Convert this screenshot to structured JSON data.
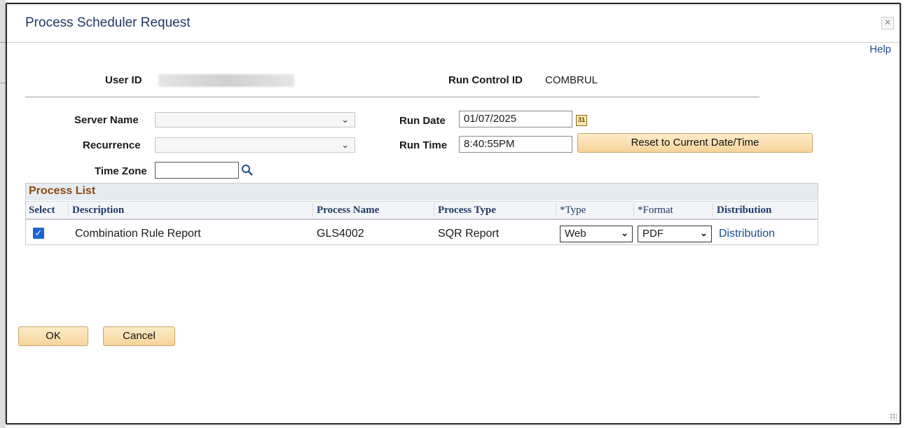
{
  "dialog": {
    "title": "Process Scheduler Request",
    "help": "Help",
    "close_icon": "close-icon"
  },
  "header": {
    "user_id_label": "User ID",
    "run_control_label": "Run Control ID",
    "run_control_value": "COMBRUL"
  },
  "form": {
    "server_name_label": "Server Name",
    "server_name_value": "",
    "recurrence_label": "Recurrence",
    "recurrence_value": "",
    "time_zone_label": "Time Zone",
    "time_zone_value": "",
    "run_date_label": "Run Date",
    "run_date_value": "01/07/2025",
    "run_time_label": "Run Time",
    "run_time_value": "8:40:55PM",
    "reset_button": "Reset to Current Date/Time"
  },
  "process_list": {
    "title": "Process List",
    "columns": [
      "Select",
      "Description",
      "Process Name",
      "Process Type",
      "*Type",
      "*Format",
      "Distribution"
    ],
    "rows": [
      {
        "selected": true,
        "description": "Combination Rule Report",
        "process_name": "GLS4002",
        "process_type": "SQR Report",
        "type": "Web",
        "format": "PDF",
        "distribution": "Distribution"
      }
    ]
  },
  "footer": {
    "ok": "OK",
    "cancel": "Cancel"
  },
  "colors": {
    "title": "#1f3a64",
    "link": "#1a4f8f",
    "grid_title": "#8a4b12",
    "button_bg": "#f7d49a"
  }
}
